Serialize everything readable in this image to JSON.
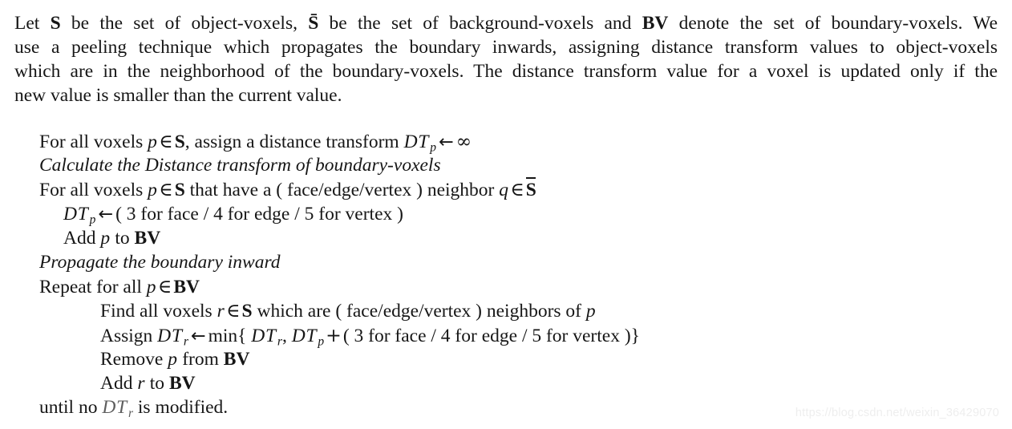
{
  "document": {
    "type": "algorithm-description",
    "intro_paragraph": {
      "full_text": "Let S be the set of object-voxels, S̄ be the set of background-voxels and BV denote the set of boundary-voxels. We use a peeling technique which propagates the boundary inwards, assigning distance transform values to object-voxels which are in the neighborhood of the boundary-voxels. The distance transform value for a voxel is updated only if the new value is smaller than the current value.",
      "lines": [
        {
          "segments": [
            "Let ",
            "S",
            " be the set of object-voxels, ",
            "S̄",
            " be the set of background-voxels and ",
            "BV",
            " denote the set of boundary-voxels. We"
          ]
        },
        {
          "text": "use a peeling technique which propagates the boundary inwards, assigning distance transform values to object-voxels"
        },
        {
          "text": "which are in the neighborhood of the boundary-voxels. The distance transform value for a voxel is updated only if the"
        },
        {
          "text": "new value is smaller than the current value."
        }
      ],
      "symbols": {
        "object_voxels_set": "S",
        "background_voxels_set": "S̄",
        "boundary_voxels_set": "BV"
      }
    },
    "algorithm": {
      "lines": [
        {
          "id": "init-dt",
          "indent": 0,
          "style": "normal",
          "text": "For all voxels p ∈ S, assign a distance transform DT_p ← ∞",
          "parts": {
            "pre": "For all voxels ",
            "var1": "p",
            "in": "∈",
            "set1": "S",
            "mid": ", assign a distance transform ",
            "dt": "DT",
            "dt_sub": "p",
            "arrow": "←",
            "value": "∞"
          }
        },
        {
          "id": "comment-calculate",
          "indent": 0,
          "style": "italic",
          "text": "Calculate the Distance transform of boundary-voxels"
        },
        {
          "id": "find-boundary",
          "indent": 0,
          "style": "normal",
          "text": "For all voxels p ∈ S that have a ( face/edge/vertex ) neighbor q ∈ S̄",
          "parts": {
            "pre": "For all voxels ",
            "var1": "p",
            "in": "∈",
            "set1": "S",
            "mid": " that have a ( face/edge/vertex ) neighbor ",
            "var2": "q",
            "in2": "∈",
            "set2": "S̄"
          }
        },
        {
          "id": "assign-boundary-dt",
          "indent": 1,
          "style": "normal",
          "text": "DT_p ← ( 3 for face / 4 for edge / 5 for vertex )",
          "parts": {
            "dt": "DT",
            "dt_sub": "p",
            "arrow": "←",
            "value": "( 3 for face / 4 for edge / 5 for vertex )"
          }
        },
        {
          "id": "add-p-to-bv",
          "indent": 1,
          "style": "normal",
          "text": "Add p to BV",
          "parts": {
            "pre": "Add ",
            "var1": "p",
            "mid": " to ",
            "set1": "BV"
          }
        },
        {
          "id": "comment-propagate",
          "indent": 0,
          "style": "italic",
          "text": "Propagate the boundary inward"
        },
        {
          "id": "repeat-loop",
          "indent": 0,
          "style": "normal",
          "text": "Repeat for all p ∈ BV",
          "parts": {
            "pre": "Repeat for all ",
            "var1": "p",
            "in": "∈",
            "set1": "BV"
          }
        },
        {
          "id": "find-neighbors",
          "indent": 2,
          "style": "normal",
          "text": "Find all voxels r ∈ S which are ( face/edge/vertex ) neighbors of p",
          "parts": {
            "pre": "Find all voxels ",
            "var1": "r",
            "in": "∈",
            "set1": "S",
            "mid": " which are ( face/edge/vertex ) neighbors of ",
            "var2": "p"
          }
        },
        {
          "id": "assign-min",
          "indent": 2,
          "style": "normal",
          "text": "Assign DT_r ← min{ DT_r, DT_p + ( 3 for face / 4 for edge / 5 for vertex )}",
          "parts": {
            "pre": "Assign ",
            "dt1": "DT",
            "dt1_sub": "r",
            "arrow": "←",
            "min": "min{",
            "dt2": "DT",
            "dt2_sub": "r",
            "comma": ",",
            "dt3": "DT",
            "dt3_sub": "p",
            "plus": "+",
            "value": "( 3 for face / 4 for edge / 5 for vertex )}"
          }
        },
        {
          "id": "remove-p",
          "indent": 2,
          "style": "normal",
          "text": "Remove p from BV",
          "parts": {
            "pre": "Remove ",
            "var1": "p",
            "mid": " from ",
            "set1": "BV"
          }
        },
        {
          "id": "add-r-to-bv",
          "indent": 2,
          "style": "normal",
          "text": "Add r to BV",
          "parts": {
            "pre": "Add ",
            "var1": "r",
            "mid": " to ",
            "set1": "BV"
          }
        },
        {
          "id": "until-condition",
          "indent": 0,
          "style": "normal",
          "text": "until no DT_r is modified.",
          "parts": {
            "pre": "until no ",
            "dt": "DT",
            "dt_sub": "r",
            "post": " is modified."
          }
        }
      ]
    }
  },
  "watermark": {
    "text": "https://blog.csdn.net/weixin_36429070",
    "color": "#eeeeee"
  }
}
